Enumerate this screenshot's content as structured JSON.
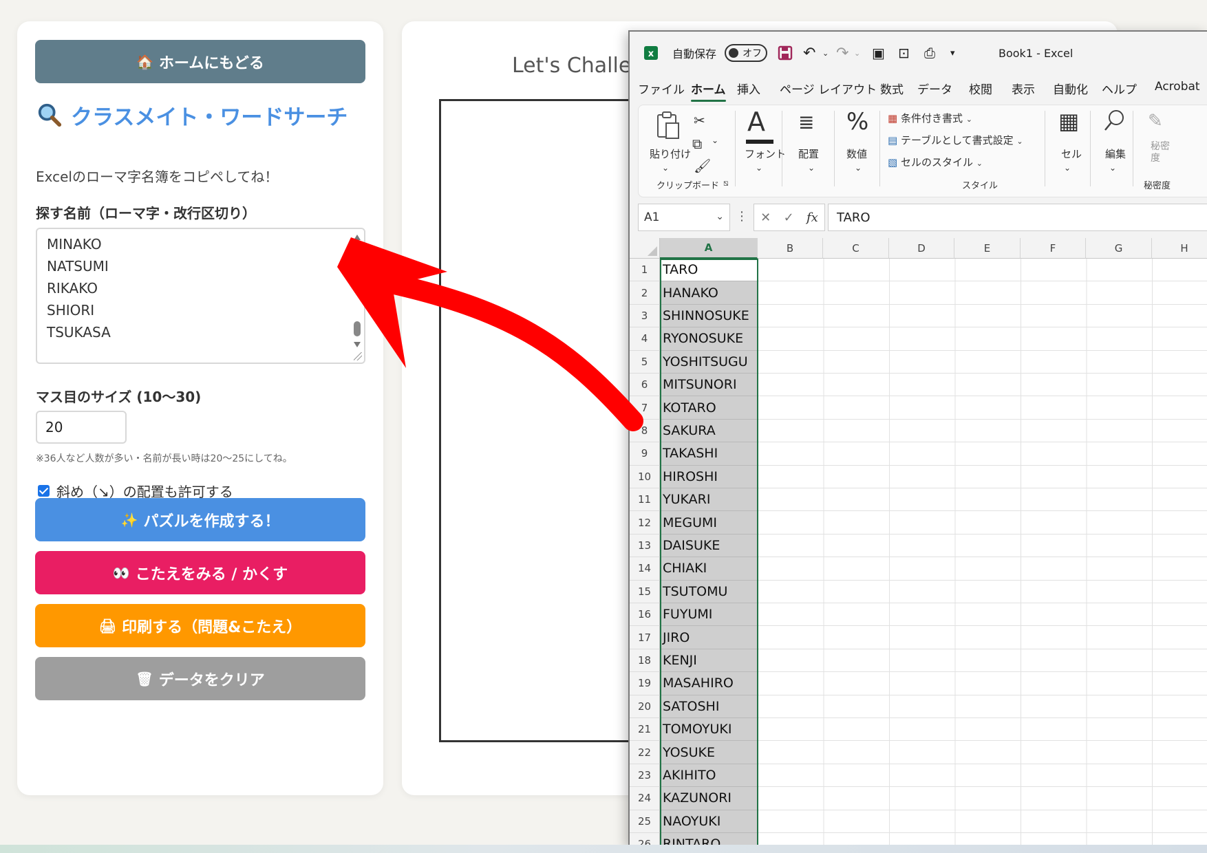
{
  "left_panel": {
    "home_button": "ホームにもどる",
    "home_icon": "🏠",
    "title": "クラスメイト・ワードサーチ",
    "title_icon": "magnifier-icon",
    "subtitle": "Excelのローマ字名簿をコピペしてね！",
    "names_label": "探す名前（ローマ字・改行区切り）",
    "names_visible": [
      "MINAKO",
      "NATSUMI",
      "RIKAKO",
      "SHIORI",
      "TSUKASA"
    ],
    "size_label": "マス目のサイズ (10〜30)",
    "size_value": "20",
    "size_note": "※36人など人数が多い・名前が長い時は20〜25にしてね。",
    "diagonal_label": "斜め（↘）の配置も許可する",
    "diagonal_checked": true,
    "create_button": "パズルを作成する！",
    "create_icon": "✨",
    "answer_button": "こたえをみる / かくす",
    "answer_icon": "👀",
    "print_button": "印刷する（問題&こたえ）",
    "print_icon": "🖨",
    "clear_button": "データをクリア",
    "clear_icon": "🗑"
  },
  "middle_panel": {
    "challenge_title": "Let's Challenge!"
  },
  "excel": {
    "autosave_label": "自動保存",
    "autosave_state": "オフ",
    "window_title": "Book1 - Excel",
    "menu": [
      "ファイル",
      "ホーム",
      "挿入",
      "ページ レイアウト",
      "数式",
      "データ",
      "校閲",
      "表示",
      "自動化",
      "ヘルプ",
      "Acrobat"
    ],
    "active_menu": "ホーム",
    "ribbon": {
      "paste": "貼り付け",
      "clipboard": "クリップボード",
      "font": "フォント",
      "alignment": "配置",
      "number": "数値",
      "cond_format": "条件付き書式",
      "table_format": "テーブルとして書式設定",
      "cell_style": "セルのスタイル",
      "style": "スタイル",
      "cells": "セル",
      "edit": "編集",
      "sensitivity": "秘密度",
      "sensitivity_short": "秘密度"
    },
    "name_box": "A1",
    "fx_label": "fx",
    "formula": "TARO",
    "columns": [
      "A",
      "B",
      "C",
      "D",
      "E",
      "F",
      "G",
      "H"
    ],
    "names": [
      "TARO",
      "HANAKO",
      "SHINNOSUKE",
      "RYONOSUKE",
      "YOSHITSUGU",
      "MITSUNORI",
      "KOTARO",
      "SAKURA",
      "TAKASHI",
      "HIROSHI",
      "YUKARI",
      "MEGUMI",
      "DAISUKE",
      "CHIAKI",
      "TSUTOMU",
      "FUYUMI",
      "JIRO",
      "KENJI",
      "MASAHIRO",
      "SATOSHI",
      "TOMOYUKI",
      "YOSUKE",
      "AKIHITO",
      "KAZUNORI",
      "NAOYUKI",
      "RINTARO"
    ]
  },
  "colors": {
    "home": "#607d8b",
    "title": "#4a90e2",
    "create": "#4a90e2",
    "answer": "#e91e63",
    "print": "#ff9800",
    "clear": "#9e9e9e",
    "arrow": "#ff0000",
    "excel_green": "#217346"
  }
}
